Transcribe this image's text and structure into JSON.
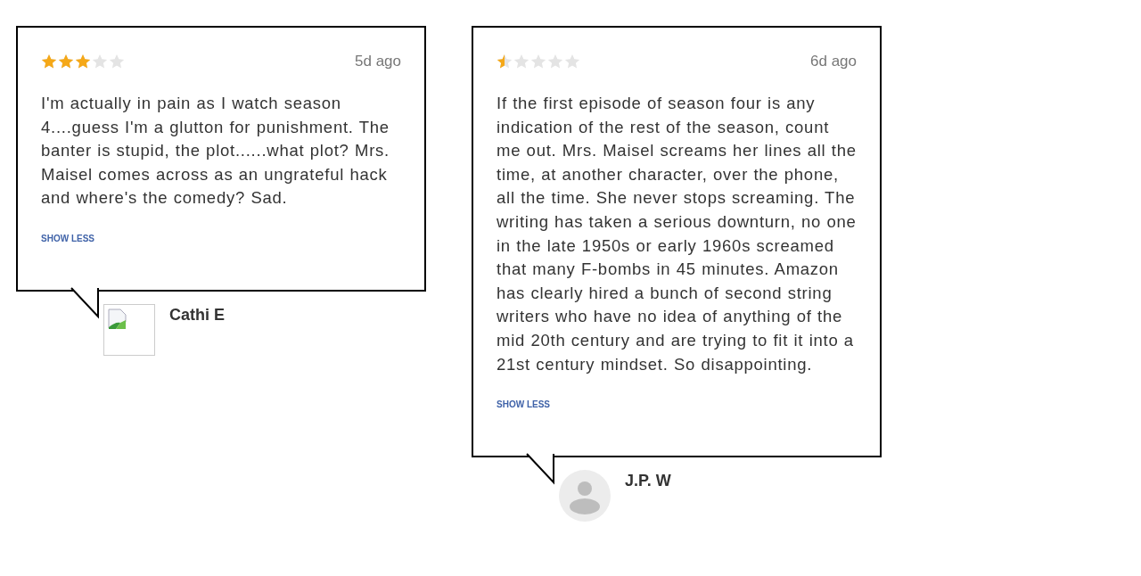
{
  "reviews": [
    {
      "stars": 3,
      "time": "5d ago",
      "text": "I'm actually in pain as I watch season 4....guess I'm a glutton for punishment. The banter is stupid, the plot......what plot? Mrs. Maisel comes across as an ungrateful hack and where's the comedy? Sad.",
      "toggle": "SHOW LESS",
      "author": "Cathi E",
      "avatar": {
        "kind": "broken-image"
      }
    },
    {
      "stars": 0.5,
      "time": "6d ago",
      "text": "If the first episode of season four is any indication of the rest of the season, count me out. Mrs. Maisel screams her lines all the time, at another character, over the phone, all the time. She never stops screaming. The writing has taken a serious downturn, no one in the late 1950s or early 1960s screamed that many F-bombs in 45 minutes. Amazon has clearly hired a bunch of second string writers who have no idea of anything of the mid 20th century and are trying to fit it into a 21st century mindset. So disappointing.",
      "toggle": "SHOW LESS",
      "author": "J.P. W",
      "avatar": {
        "kind": "default"
      }
    }
  ]
}
